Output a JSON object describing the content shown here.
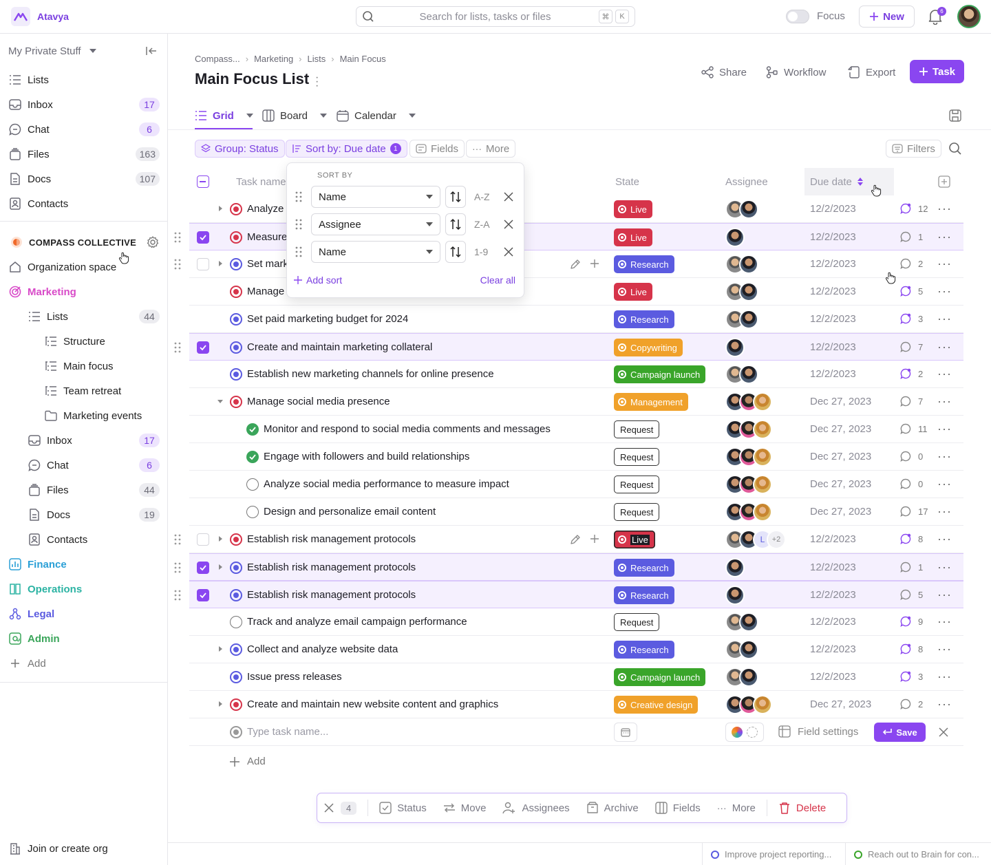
{
  "app": {
    "name": "Atavya"
  },
  "topbar": {
    "search_placeholder": "Search for lists, tasks or files",
    "kbd_cmd": "⌘",
    "kbd_k": "K",
    "focus_label": "Focus",
    "new_label": "New",
    "notif_count": "6"
  },
  "sidebar": {
    "space_label": "My Private Stuff",
    "personal": [
      {
        "label": "Lists",
        "icon": "list-icon",
        "count": ""
      },
      {
        "label": "Inbox",
        "icon": "inbox-icon",
        "count": "17",
        "accent": true
      },
      {
        "label": "Chat",
        "icon": "chat-icon",
        "count": "6",
        "accent": true
      },
      {
        "label": "Files",
        "icon": "files-icon",
        "count": "163"
      },
      {
        "label": "Docs",
        "icon": "docs-icon",
        "count": "107"
      },
      {
        "label": "Contacts",
        "icon": "contacts-icon",
        "count": ""
      }
    ],
    "org_name": "COMPASS COLLECTIVE",
    "org_space": "Organization space",
    "marketing": "Marketing",
    "marketing_children": [
      {
        "label": "Lists",
        "count": "44"
      },
      {
        "label": "Structure"
      },
      {
        "label": "Main focus"
      },
      {
        "label": "Team retreat"
      },
      {
        "label": "Marketing events"
      },
      {
        "label": "Inbox",
        "count": "17"
      },
      {
        "label": "Chat",
        "count": "6"
      },
      {
        "label": "Files",
        "count": "44"
      },
      {
        "label": "Docs",
        "count": "19"
      },
      {
        "label": "Contacts"
      }
    ],
    "spaces": [
      {
        "label": "Finance",
        "color": "#2a9fd6"
      },
      {
        "label": "Operations",
        "color": "#2bb3a3"
      },
      {
        "label": "Legal",
        "color": "#5b5be0"
      },
      {
        "label": "Admin",
        "color": "#3aa55a"
      }
    ],
    "add_label": "Add",
    "join_label": "Join or create org"
  },
  "breadcrumbs": [
    "Compass...",
    "Marketing",
    "Lists",
    "Main Focus"
  ],
  "page_title": "Main Focus List",
  "header_actions": {
    "share": "Share",
    "workflow": "Workflow",
    "export": "Export",
    "task": "Task"
  },
  "views": {
    "grid": "Grid",
    "board": "Board",
    "calendar": "Calendar"
  },
  "toolbar": {
    "group": "Group: Status",
    "sort": "Sort by: Due date",
    "sort_count": "1",
    "fields": "Fields",
    "more": "More",
    "filters": "Filters"
  },
  "columns": {
    "task_name": "Task name",
    "state": "State",
    "assignee": "Assignee",
    "due_date": "Due date"
  },
  "sort_popup": {
    "header": "SORT BY",
    "rules": [
      {
        "field": "Name",
        "order": "A-Z"
      },
      {
        "field": "Assignee",
        "order": "Z-A"
      },
      {
        "field": "Name",
        "order": "1-9"
      }
    ],
    "add_sort": "Add sort",
    "clear_all": "Clear all"
  },
  "tasks": [
    {
      "name": "Analyze",
      "state": "Live",
      "due": "12/2/2023",
      "comments": "12"
    },
    {
      "name": "Measure",
      "state": "Live",
      "due": "12/2/2023",
      "comments": "1"
    },
    {
      "name": "Set mark",
      "state": "Research",
      "due": "12/2/2023",
      "comments": "2"
    },
    {
      "name": "Manage",
      "state": "Live",
      "due": "12/2/2023",
      "comments": "5"
    },
    {
      "name": "Set paid marketing budget for 2024",
      "state": "Research",
      "due": "12/2/2023",
      "comments": "3"
    },
    {
      "name": "Create and maintain marketing collateral",
      "state": "Copywriting",
      "due": "12/2/2023",
      "comments": "7"
    },
    {
      "name": "Establish new marketing channels for online presence",
      "state": "Campaign launch",
      "due": "12/2/2023",
      "comments": "2"
    },
    {
      "name": "Manage social media presence",
      "state": "Management",
      "due": "Dec 27, 2023",
      "comments": "7"
    },
    {
      "name": "Monitor and respond to social media comments and messages",
      "state": "Request",
      "due": "Dec 27, 2023",
      "comments": "11"
    },
    {
      "name": "Engage with followers and build relationships",
      "state": "Request",
      "due": "Dec 27, 2023",
      "comments": "0"
    },
    {
      "name": "Analyze social media performance to measure impact",
      "state": "Request",
      "due": "Dec 27, 2023",
      "comments": "0"
    },
    {
      "name": "Design and personalize email content",
      "state": "Request",
      "due": "Dec 27, 2023",
      "comments": "17"
    },
    {
      "name": "Establish risk management protocols",
      "state": "Live",
      "due": "12/2/2023",
      "comments": "8",
      "extra_assignees": "+2",
      "initial": "L"
    },
    {
      "name": "Establish risk management protocols",
      "state": "Research",
      "due": "12/2/2023",
      "comments": "1"
    },
    {
      "name": "Establish risk management protocols",
      "state": "Research",
      "due": "12/2/2023",
      "comments": "5"
    },
    {
      "name": "Track and analyze email campaign performance",
      "state": "Request",
      "due": "12/2/2023",
      "comments": "9"
    },
    {
      "name": "Collect and analyze website data",
      "state": "Research",
      "due": "12/2/2023",
      "comments": "8"
    },
    {
      "name": "Issue press releases",
      "state": "Campaign launch",
      "due": "12/2/2023",
      "comments": "3"
    },
    {
      "name": "Create and maintain new website content and graphics",
      "state": "Creative design",
      "due": "Dec 27, 2023",
      "comments": "2"
    }
  ],
  "state_colors": {
    "Live": "#d6344a",
    "Research": "#5b5be0",
    "Copywriting": "#f0a12a",
    "Campaign launch": "#3aa52a",
    "Management": "#f0a12a",
    "Creative design": "#f0a12a"
  },
  "new_task": {
    "placeholder": "Type task name...",
    "field_settings": "Field settings",
    "save": "Save"
  },
  "add_row_label": "Add",
  "bulk": {
    "count": "4",
    "status": "Status",
    "move": "Move",
    "assignees": "Assignees",
    "archive": "Archive",
    "fields": "Fields",
    "more": "More",
    "delete": "Delete"
  },
  "statusbar": {
    "item1": "Improve project reporting...",
    "item2": "Reach out to Brain for con..."
  }
}
